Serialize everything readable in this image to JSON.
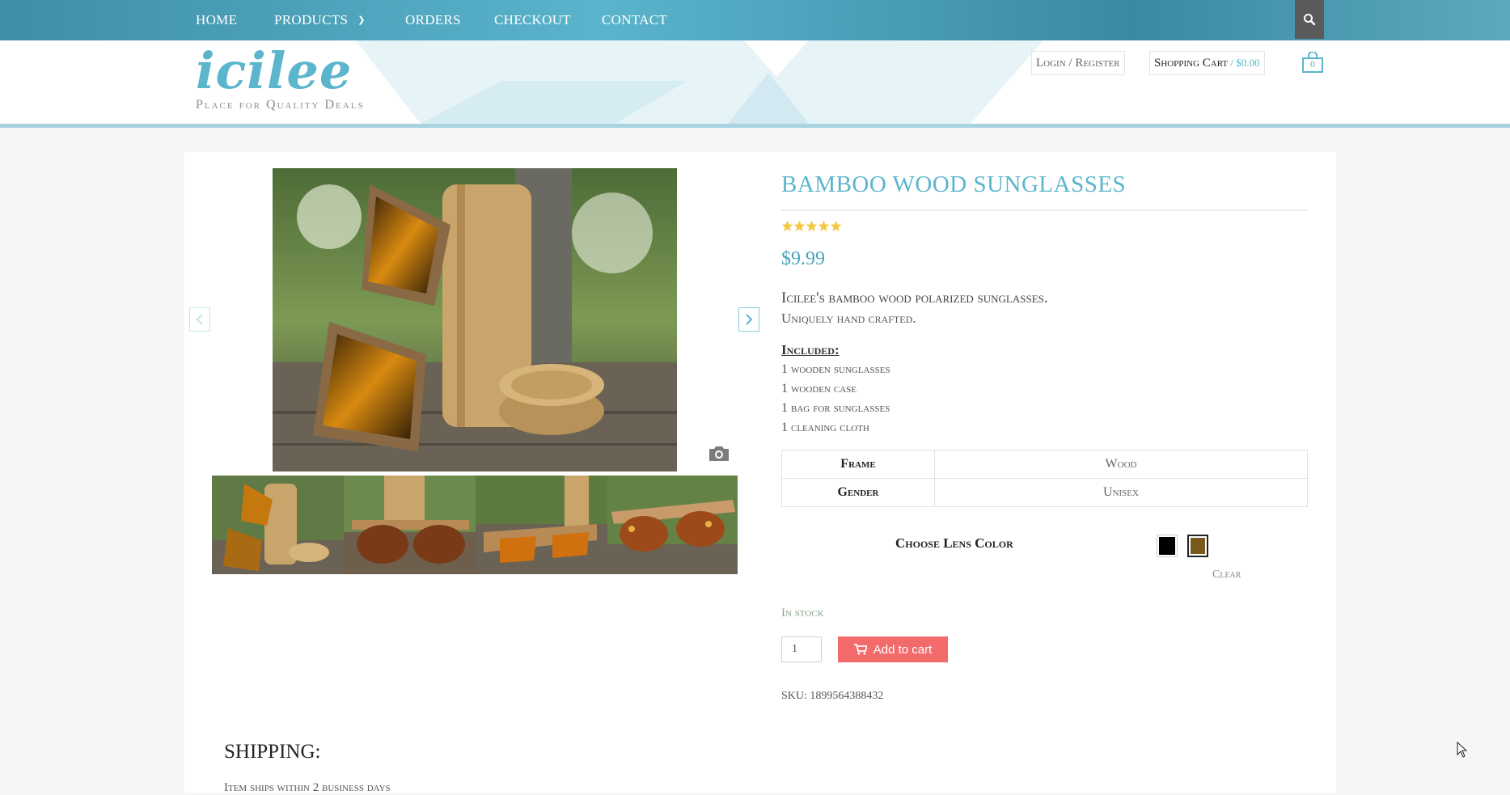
{
  "nav": {
    "items": [
      {
        "label": "HOME"
      },
      {
        "label": "PRODUCTS"
      },
      {
        "label": "ORDERS"
      },
      {
        "label": "CHECKOUT"
      },
      {
        "label": "CONTACT"
      }
    ],
    "dropdown_icon": "chevron-down-icon",
    "search_icon": "search-icon"
  },
  "header": {
    "logo": "icilee",
    "tagline": "Place for Quality Deals",
    "login": "Login / Register",
    "cart_label": "Shopping Cart",
    "cart_separator": " / ",
    "cart_total": "$0.00",
    "cart_count": "0"
  },
  "product": {
    "title": "BAMBOO WOOD SUNGLASSES",
    "rating": 5,
    "price": "$9.99",
    "description_line1": "Icilee's bamboo wood polarized sunglasses.",
    "description_line2": "Uniquely hand crafted.",
    "included_heading": "Included:",
    "included_items": [
      "1 wooden sunglasses",
      "1 wooden case",
      "1 bag for sunglasses",
      "1 cleaning cloth"
    ],
    "attributes": [
      {
        "name": "Frame",
        "value": "Wood"
      },
      {
        "name": "Gender",
        "value": "Unisex"
      }
    ],
    "lens_label": "Choose Lens Color",
    "lens_options": [
      {
        "color": "#000000",
        "selected": false
      },
      {
        "color": "#7a5a1c",
        "selected": true
      }
    ],
    "clear_label": "Clear",
    "stock": "In stock",
    "quantity": "1",
    "add_to_cart": "Add to cart",
    "sku": "SKU: 1899564388432"
  },
  "shipping": {
    "heading": "SHIPPING:",
    "text": "Item ships within 2 business days"
  },
  "colors": {
    "accent": "#5bb5cc",
    "add_to_cart": "#f36a6a",
    "nav_bg": "#4a9fb8"
  }
}
